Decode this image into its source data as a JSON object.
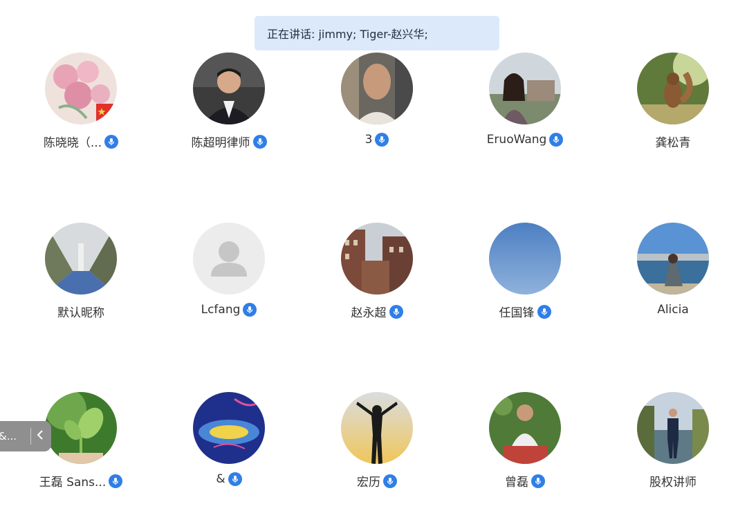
{
  "speaker_banner": {
    "text": "正在讲话: jimmy; Tiger-赵兴华;"
  },
  "side_tab": {
    "label": "&...",
    "collapse_icon": "chevron-left-icon"
  },
  "participants": [
    {
      "name": "陈晓晓（...",
      "mic": true,
      "avatar": "pink-flowers-photo",
      "flag": true
    },
    {
      "name": "陈超明律师",
      "mic": true,
      "avatar": "man-in-suit-photo"
    },
    {
      "name": "3",
      "mic": true,
      "avatar": "man-selfie-photo"
    },
    {
      "name": "EruoWang",
      "mic": true,
      "avatar": "woman-outdoors-photo"
    },
    {
      "name": "龚松青",
      "mic": false,
      "avatar": "squirrel-photo"
    },
    {
      "name": "默认昵称",
      "mic": false,
      "avatar": "forest-road-photo"
    },
    {
      "name": "Lcfang",
      "mic": true,
      "avatar": "default-person-placeholder"
    },
    {
      "name": "赵永超",
      "mic": true,
      "avatar": "buildings-photo"
    },
    {
      "name": "任国锋",
      "mic": true,
      "avatar": "blue-sky-photo"
    },
    {
      "name": "Alicia",
      "mic": false,
      "avatar": "woman-by-water-photo"
    },
    {
      "name": "王磊 Sans...",
      "mic": true,
      "avatar": "green-sprout-photo"
    },
    {
      "name": "&",
      "mic": true,
      "avatar": "blue-artwork-image"
    },
    {
      "name": "宏历",
      "mic": true,
      "avatar": "silhouette-sunset-photo"
    },
    {
      "name": "曾磊",
      "mic": true,
      "avatar": "man-gardening-photo"
    },
    {
      "name": "股权讲师",
      "mic": false,
      "avatar": "man-standing-park-photo"
    }
  ]
}
